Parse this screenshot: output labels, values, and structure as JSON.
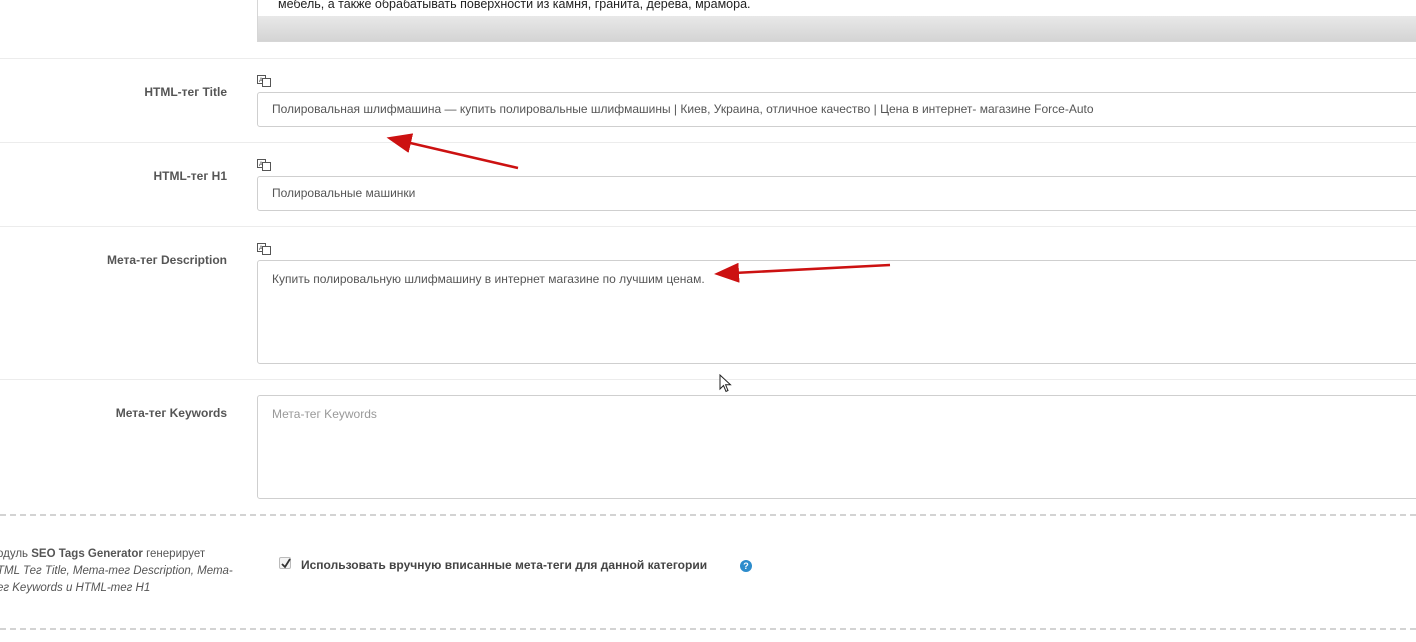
{
  "top_editor": {
    "text": "мебель, а также обрабатывать поверхности из камня, гранита, дерева, мрамора."
  },
  "fields": {
    "title": {
      "label": "HTML-тег Title",
      "value": "Полировальная шлифмашина — купить полировальные шлифмашины | Киев, Украина, отличное качество | Цена в интернет- магазине Force-Auto"
    },
    "h1": {
      "label": "HTML-тег H1",
      "value": "Полировальные машинки"
    },
    "description": {
      "label": "Мета-тег Description",
      "value": "Купить полировальную шлифмашину в интернет магазине по лучшим ценам."
    },
    "keywords": {
      "label": "Мета-тег Keywords",
      "placeholder": "Мета-тег Keywords"
    }
  },
  "seo_note": {
    "prefix": "одуль ",
    "module_name": "SEO Tags Generator",
    "middle": " генерирует",
    "italic_text": "TML Тег Title, Мета-тег Description, Мета-ег Keywords и HTML-тег H1"
  },
  "manual_meta": {
    "label": "Использовать вручную вписанные мета-теги для данной категории",
    "checked": true,
    "help_symbol": "?"
  },
  "colors": {
    "annotation_arrow": "#cc1111",
    "help_icon": "#2d8ccc"
  }
}
